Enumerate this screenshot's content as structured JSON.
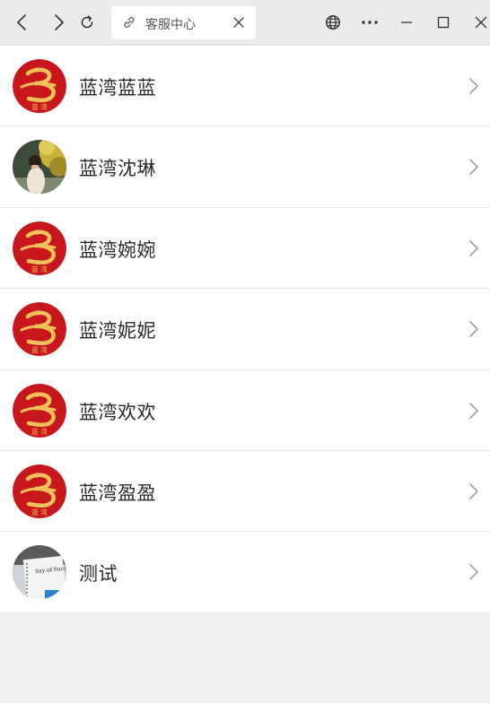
{
  "browser": {
    "tab_title": "客服中心",
    "icons": [
      "back-icon",
      "forward-icon",
      "refresh-icon",
      "link-icon",
      "close-icon",
      "globe-icon",
      "more-icon",
      "minimize-icon",
      "maximize-icon",
      "window-close-icon"
    ]
  },
  "contacts": [
    {
      "name": "蓝湾蓝蓝",
      "avatar": "logo",
      "logo_text": "蓝 湾"
    },
    {
      "name": "蓝湾沈琳",
      "avatar": "photo"
    },
    {
      "name": "蓝湾婉婉",
      "avatar": "logo",
      "logo_text": "蓝 湾"
    },
    {
      "name": "蓝湾妮妮",
      "avatar": "logo",
      "logo_text": "蓝 湾"
    },
    {
      "name": "蓝湾欢欢",
      "avatar": "logo",
      "logo_text": "蓝 湾"
    },
    {
      "name": "蓝湾盈盈",
      "avatar": "logo",
      "logo_text": "蓝 湾"
    },
    {
      "name": "测试",
      "avatar": "notebook",
      "notebook_text": "Say of Success"
    }
  ],
  "colors": {
    "logo_red": "#c8161d",
    "logo_gold": "#f2c25a",
    "chrome_bg": "#ebebeb",
    "page_bg": "#f0f0f0"
  }
}
